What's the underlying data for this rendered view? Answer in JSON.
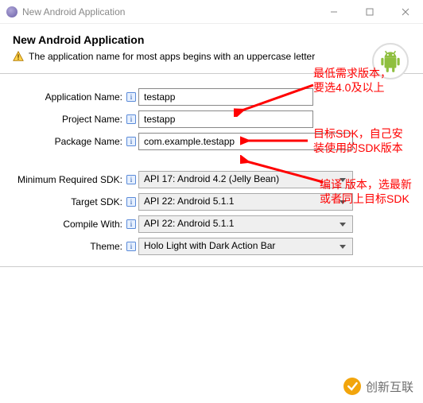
{
  "titlebar": {
    "title": "New Android Application"
  },
  "header": {
    "title": "New Android Application",
    "message": "The application name for most apps begins with an uppercase letter"
  },
  "form": {
    "app_name_label": "Application Name:",
    "app_name_value": "testapp",
    "project_name_label": "Project Name:",
    "project_name_value": "testapp",
    "package_name_label": "Package Name:",
    "package_name_value": "com.example.testapp",
    "min_sdk_label": "Minimum Required SDK:",
    "min_sdk_value": "API 17: Android 4.2 (Jelly Bean)",
    "target_sdk_label": "Target SDK:",
    "target_sdk_value": "API 22: Android 5.1.1",
    "compile_label": "Compile With:",
    "compile_value": "API 22: Android 5.1.1",
    "theme_label": "Theme:",
    "theme_value": "Holo Light with Dark Action Bar"
  },
  "annotations": {
    "min_sdk": "最低需求版本，\n要选4.0及以上",
    "target_sdk": "目标SDK，自己安\n装使用的SDK版本",
    "compile": "编译 版本，选最新\n或者同上目标SDK"
  },
  "watermark": {
    "text": "创新互联"
  },
  "colors": {
    "annotation": "#ff0000"
  }
}
